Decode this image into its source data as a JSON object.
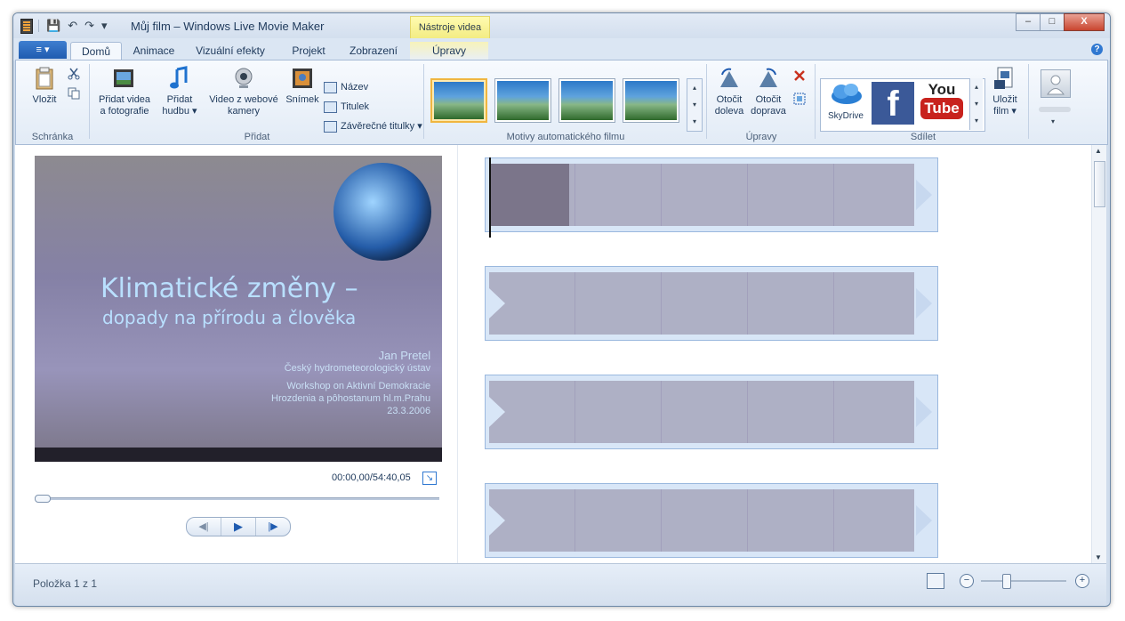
{
  "window": {
    "title": "Můj film – Windows Live Movie Maker",
    "context_tab_header": "Nástroje videa",
    "buttons": {
      "minimize": "–",
      "maximize": "□",
      "close": "X"
    }
  },
  "quick_access": {
    "save_icon": "💾",
    "undo_icon": "↶",
    "redo_icon": "↷",
    "customize_icon": "▾"
  },
  "tabs": {
    "app_menu": "≡ ▾",
    "items": [
      "Domů",
      "Animace",
      "Vizuální efekty",
      "Projekt",
      "Zobrazení",
      "Úpravy"
    ],
    "active": "Domů",
    "help": "?"
  },
  "ribbon": {
    "clipboard": {
      "label": "Schránka",
      "paste": "Vložit"
    },
    "add": {
      "label": "Přidat",
      "add_videos_line1": "Přidat videa",
      "add_videos_line2": "a fotografie",
      "add_music_line1": "Přidat",
      "add_music_line2": "hudbu ▾",
      "webcam_line1": "Video z webové",
      "webcam_line2": "kamery",
      "snapshot": "Snímek",
      "title": "Název",
      "caption": "Titulek",
      "credits": "Závěrečné titulky ▾"
    },
    "themes": {
      "label": "Motivy automatického filmu",
      "scroll_up": "▴",
      "scroll_down": "▾",
      "more": "▾"
    },
    "editing": {
      "label": "Úpravy",
      "rotate_left_1": "Otočit",
      "rotate_left_2": "doleva",
      "rotate_right_1": "Otočit",
      "rotate_right_2": "doprava"
    },
    "share": {
      "label": "Sdílet",
      "skydrive": "SkyDrive",
      "facebook": "f",
      "youtube_1": "You",
      "youtube_2": "Tube",
      "save_movie_1": "Uložit",
      "save_movie_2": "film ▾"
    }
  },
  "preview": {
    "slide_title": "Klimatické změny –",
    "slide_subtitle": "dopady na přírodu a člověka",
    "slide_author": "Jan Pretel",
    "slide_institute": "Český hydrometeorologický ústav",
    "slide_event_1": "Workshop on Aktivní Demokracie",
    "slide_event_2": "Hrozdenia a pôhostanum hl.m.Prahu",
    "slide_date": "23.3.2006",
    "timecode": "00:00,00/54:40,05",
    "fullscreen_icon": "↘",
    "prev_frame": "◀|",
    "play": "▶",
    "next_frame": "|▶"
  },
  "storyboard": {
    "clips": 4,
    "scroll_up": "▲",
    "scroll_down": "▼"
  },
  "status": {
    "item": "Položka 1 z 1",
    "zoom_out": "−",
    "zoom_in": "+",
    "zoom_level_fraction": 0.28
  }
}
